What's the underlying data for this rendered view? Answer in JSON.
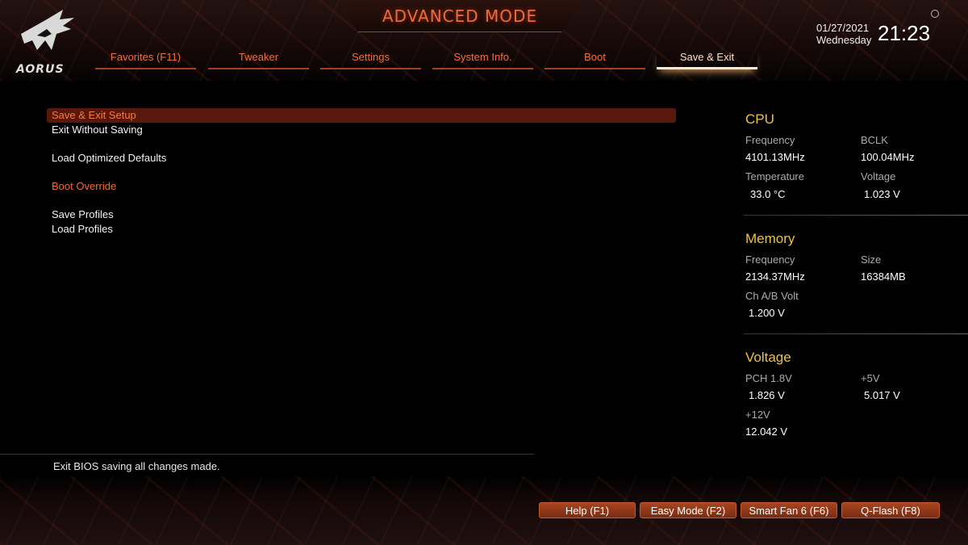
{
  "header": {
    "mode_title": "ADVANCED MODE",
    "logo_text": "AORUS",
    "date": "01/27/2021",
    "weekday": "Wednesday",
    "time": "21:23"
  },
  "tabs": [
    {
      "label": "Favorites (F11)",
      "active": false
    },
    {
      "label": "Tweaker",
      "active": false
    },
    {
      "label": "Settings",
      "active": false
    },
    {
      "label": "System Info.",
      "active": false
    },
    {
      "label": "Boot",
      "active": false
    },
    {
      "label": "Save & Exit",
      "active": true
    }
  ],
  "menu": {
    "items": [
      {
        "label": "Save & Exit Setup"
      },
      {
        "label": "Exit Without Saving"
      },
      {
        "label": "Load Optimized Defaults"
      },
      {
        "label": "Boot Override"
      },
      {
        "label": "Save Profiles"
      },
      {
        "label": "Load Profiles"
      }
    ]
  },
  "hint": "Exit BIOS saving all changes made.",
  "panel": {
    "cpu": {
      "title": "CPU",
      "frequency_label": "Frequency",
      "frequency": "4101.13MHz",
      "bclk_label": "BCLK",
      "bclk": "100.04MHz",
      "temperature_label": "Temperature",
      "temperature": "33.0 °C",
      "voltage_label": "Voltage",
      "voltage": "1.023 V"
    },
    "memory": {
      "title": "Memory",
      "frequency_label": "Frequency",
      "frequency": "2134.37MHz",
      "size_label": "Size",
      "size": "16384MB",
      "volt_label": "Ch A/B Volt",
      "volt": "1.200 V"
    },
    "voltage": {
      "title": "Voltage",
      "pch_label": "PCH 1.8V",
      "pch": "1.826 V",
      "v5_label": "+5V",
      "v5": "5.017 V",
      "v12_label": "+12V",
      "v12": "12.042 V"
    }
  },
  "footer": {
    "buttons": [
      {
        "label": "Help (F1)"
      },
      {
        "label": "Easy Mode (F2)"
      },
      {
        "label": "Smart Fan 6 (F6)"
      },
      {
        "label": "Q-Flash (F8)"
      }
    ]
  },
  "colors": {
    "accent": "#f07040",
    "highlight_bg": "#5a180c",
    "section_title": "#f0c040"
  }
}
